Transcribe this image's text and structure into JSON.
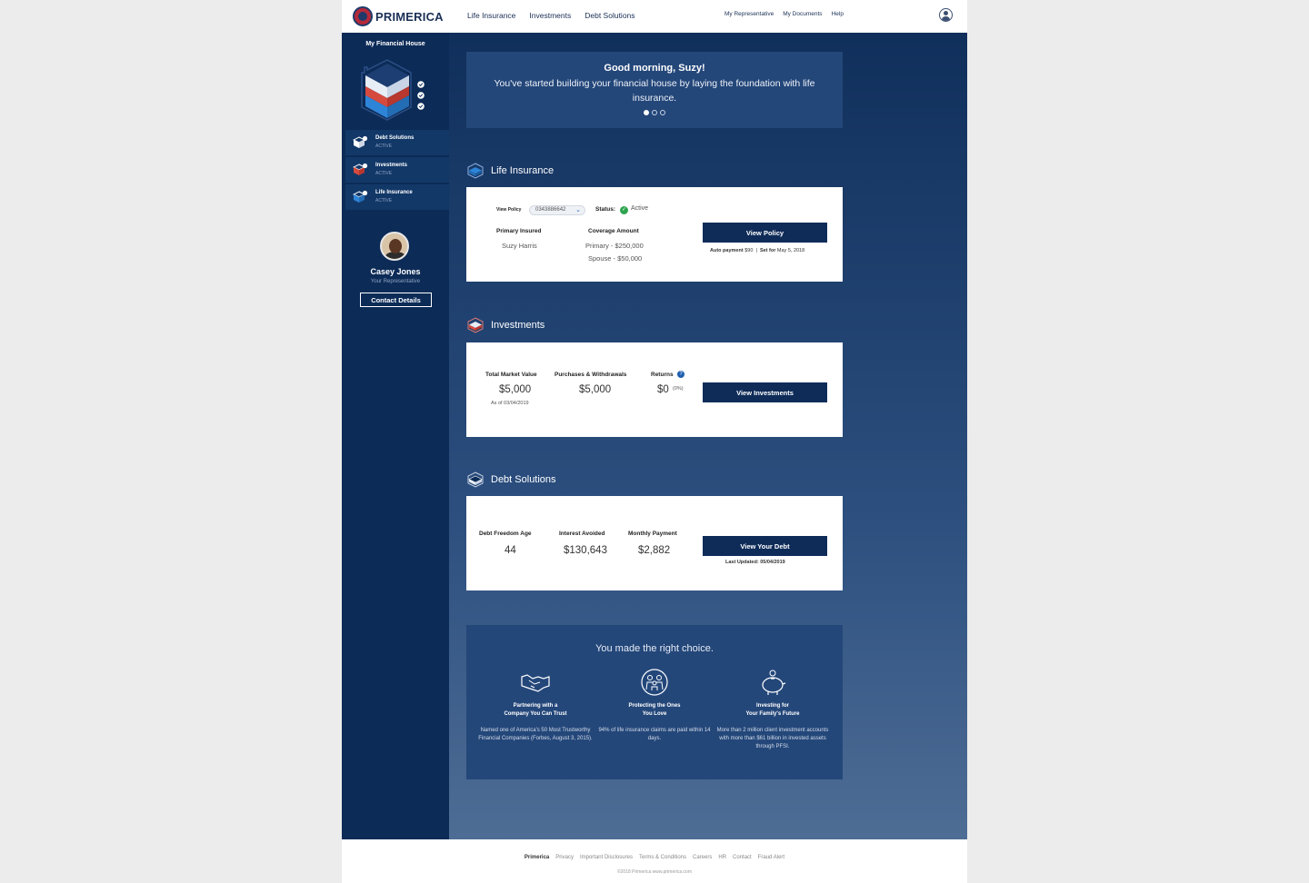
{
  "header": {
    "logo_text": "PRIMERICA",
    "main_nav": [
      "Life Insurance",
      "Investments",
      "Debt Solutions"
    ],
    "util_nav": [
      "My Representative",
      "My Documents",
      "Help"
    ]
  },
  "sidebar": {
    "title": "My Financial House",
    "items": [
      {
        "name": "Debt Solutions",
        "status": "ACTIVE"
      },
      {
        "name": "Investments",
        "status": "ACTIVE"
      },
      {
        "name": "Life Insurance",
        "status": "ACTIVE"
      }
    ],
    "rep": {
      "name": "Casey Jones",
      "title": "Your Representative",
      "contact_label": "Contact Details"
    }
  },
  "greeting": {
    "hello": "Good morning, Suzy!",
    "message": "You've started building your financial house by laying the foundation with life insurance."
  },
  "life": {
    "title": "Life Insurance",
    "view_policy_label": "View Policy",
    "policy_number": "0343886642",
    "status_label": "Status:",
    "status_value": "Active",
    "primary_insured_label": "Primary Insured",
    "primary_insured": "Suzy Harris",
    "coverage_label": "Coverage Amount",
    "coverage_primary": "Primary - $250,000",
    "coverage_spouse": "Spouse - $50,000",
    "button": "View Policy",
    "autopay_label": "Auto payment",
    "autopay_value": "$90",
    "setfor_label": "Set for",
    "setfor_value": "May 5, 2018"
  },
  "investments": {
    "title": "Investments",
    "tmv_label": "Total Market Value",
    "tmv_value": "$5,000",
    "tmv_asof": "As of 03/04/2019",
    "pw_label": "Purchases & Withdrawals",
    "pw_value": "$5,000",
    "returns_label": "Returns",
    "returns_value": "$0",
    "returns_pct": "(0%)",
    "button": "View Investments"
  },
  "debt": {
    "title": "Debt Solutions",
    "age_label": "Debt Freedom Age",
    "age_value": "44",
    "interest_label": "Interest Avoided",
    "interest_value": "$130,643",
    "monthly_label": "Monthly Payment",
    "monthly_value": "$2,882",
    "button": "View Your Debt",
    "updated": "Last Updated: 05/04/2019"
  },
  "choice": {
    "title": "You made the right choice.",
    "columns": [
      {
        "heading_1": "Partnering with a",
        "heading_2": "Company You Can Trust",
        "body": "Named one of America's 50 Most Trustworthy Financial Companies (Forbes, August 3, 2015).",
        "icon": "handshake-icon"
      },
      {
        "heading_1": "Protecting the Ones",
        "heading_2": "You Love",
        "body": "94% of life insurance claims are paid within 14 days.",
        "icon": "family-icon"
      },
      {
        "heading_1": "Investing for",
        "heading_2": "Your Family's Future",
        "body": "More than 2 million client investment accounts with more than $61 billion in invested assets through PFSI.",
        "icon": "piggy-bank-icon"
      }
    ]
  },
  "footer": {
    "links": [
      "Primerica",
      "Privacy",
      "Important Disclosures",
      "Terms & Conditions",
      "Careers",
      "HR",
      "Contact",
      "Fraud Alert"
    ],
    "copyright": "©2018 Primerica www.primerica.com"
  },
  "colors": {
    "navy": "#0c2b57",
    "card_button": "#0f2c59",
    "status_green": "#2ea44f",
    "brand_red": "#b5293a"
  }
}
